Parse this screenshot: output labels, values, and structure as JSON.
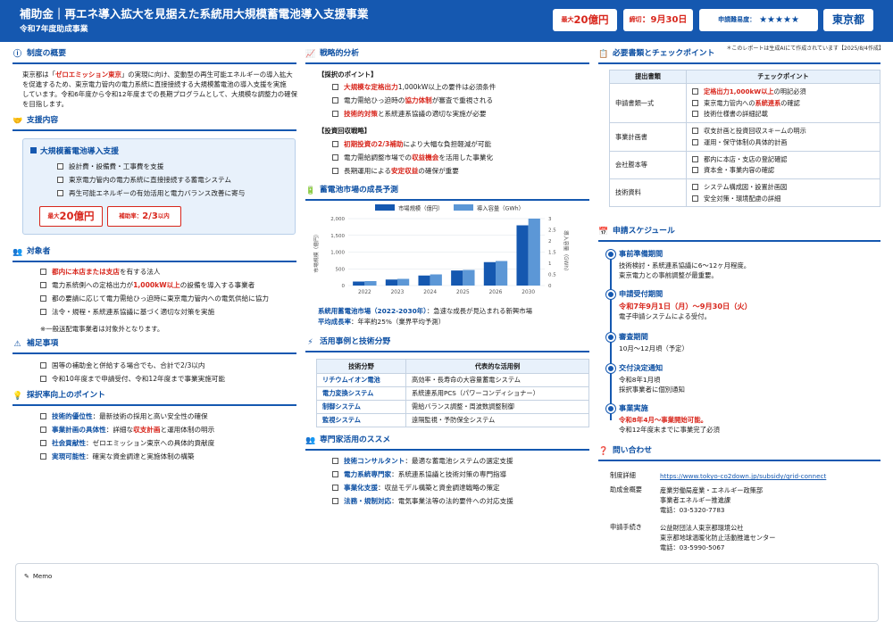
{
  "header": {
    "title": "補助金｜再エネ導入拡大を見据えた系統用大規模蓄電池導入支援事業",
    "subtitle": "令和7年度助成事業",
    "badge_max_prefix": "最大",
    "badge_max_value": "20億円",
    "badge_deadline_prefix": "締切",
    "badge_deadline_value": "：9月30日",
    "badge_difficulty_label": "申請難易度：",
    "badge_difficulty_stars": "★★★★★",
    "badge_region": "東京都"
  },
  "note": "＊このレポートは生成AIにて作成されています【2025/8/4作成】",
  "overview": {
    "title": "制度の概要",
    "p_prefix": "東京都は「",
    "p_highlight": "ゼロエミッション東京",
    "p_line1_rest": "」の実現に向け、変動型の再生可能エネルギーの導入拡大",
    "p_line2": "を促進するため、東京電力管内の電力系統に直接接続する大規模蓄電池の導入支援を実施",
    "p_line3": "しています。令和6年度から令和12年度までの長期プログラムとして、大規模な調整力の確保",
    "p_line4": "を目指します。"
  },
  "support": {
    "title": "支援内容",
    "box_title": "大規模蓄電池導入支援",
    "items": [
      "設計費・設備費・工事費を支援",
      "東京電力管内の電力系統に直接接続する蓄電システム",
      "再生可能エネルギーの有効活用と電力バランス改善に寄与"
    ],
    "badge_max_prefix": "最大",
    "badge_max_value": "20億円",
    "badge_rate_prefix": "補助率：",
    "badge_rate_value": "2/3",
    "badge_rate_suffix": "以内"
  },
  "target": {
    "title": "対象者",
    "item1_hl": "都内に本店または支店",
    "item1_rest": "を有する法人",
    "item2_pre": "電力系統側への定格出力が",
    "item2_hl": "1,000kW以上",
    "item2_rest": "の設備を導入する事業者",
    "item3": "都の要請に応じて電力需給ひっ迫時に東京電力管内への電気供給に協力",
    "item4": "法令・規程・系統連系協議に基づく適切な対策を実施",
    "note": "※一般送配電事業者は対象外となります。"
  },
  "supplement": {
    "title": "補足事項",
    "items": [
      "国等の補助金と併給する場合でも、合計で2/3以内",
      "令和10年度まで申請受付、令和12年度まで事業実施可能"
    ]
  },
  "tips": {
    "title": "採択率向上のポイント",
    "item1_k": "技術的優位性",
    "item1_v": "：最新技術の採用と高い安全性の確保",
    "item2_k": "事業計画の具体性",
    "item2_m": "：詳細な",
    "item2_hl": "収支計画",
    "item2_v": "と運用体制の明示",
    "item3_k": "社会貢献性",
    "item3_v": "：ゼロエミッション東京への具体的貢献度",
    "item4_k": "実現可能性",
    "item4_v": "：確実な資金調達と実施体制の構築"
  },
  "strategy": {
    "title": "戦略的分析",
    "adopt_head": "【採択のポイント】",
    "a1_hl": "大規模な定格出力",
    "a1_rest": "1,000kW以上の要件は必須条件",
    "a2_pre": "電力需給ひっ迫時の",
    "a2_hl": "協力体制",
    "a2_rest": "が審査で重視される",
    "a3_hl": "技術的対策",
    "a3_rest": "と系統連系協議の適切な実施が必要",
    "invest_head": "【投資回収戦略】",
    "b1_hl": "初期投資の2/3補助",
    "b1_rest": "により大幅な負担軽減が可能",
    "b2_pre": "電力需給調整市場での",
    "b2_hl": "収益機会",
    "b2_rest": "を活用した事業化",
    "b3_pre": "長期運用による",
    "b3_hl": "安定収益",
    "b3_rest": "の確保が重要"
  },
  "market": {
    "title": "蓄電池市場の成長予測",
    "caption_label": "系統用蓄電池市場（2022-2030年）",
    "caption_text": "：急速な成長が見込まれる新興市場",
    "growth_label": "平均成長率",
    "growth_text": "：年率約25%（業界平均予測）"
  },
  "chart_data": {
    "type": "bar",
    "categories": [
      "2022",
      "2023",
      "2024",
      "2025",
      "2026",
      "2030"
    ],
    "series": [
      {
        "name": "市場規模（億円）",
        "values": [
          120,
          180,
          300,
          450,
          700,
          1800
        ],
        "color": "#1558b0"
      },
      {
        "name": "導入容量（GWh）",
        "values": [
          0.2,
          0.3,
          0.5,
          0.7,
          1.1,
          3.0
        ],
        "color": "#5c97d6"
      }
    ],
    "ylabel": "市場規模（億円）",
    "y2label": "導入容量（GWh）",
    "ylim": [
      0,
      2000
    ],
    "y2lim": [
      0,
      3.0
    ],
    "yticks": [
      "0",
      "500",
      "1,000",
      "1,500",
      "2,000"
    ],
    "y2ticks": [
      "0",
      "0.5",
      "1",
      "1.5",
      "2",
      "2.5",
      "3"
    ],
    "legend_position": "top",
    "grid": true
  },
  "usecases": {
    "title": "活用事例と技術分野",
    "col1": "技術分野",
    "col2": "代表的な活用例",
    "rows": [
      {
        "k": "リチウムイオン電池",
        "v": "高効率・長寿命の大容量蓄電システム"
      },
      {
        "k": "電力変換システム",
        "v": "系統連系用PCS（パワーコンディショナー）"
      },
      {
        "k": "制御システム",
        "v": "需給バランス調整・周波数調整制御"
      },
      {
        "k": "監視システム",
        "v": "遠隔監視・予防保全システム"
      }
    ]
  },
  "experts": {
    "title": "専門家活用のススメ",
    "items": [
      {
        "k": "技術コンサルタント",
        "v": "：最適な蓄電池システムの選定支援"
      },
      {
        "k": "電力系統専門家",
        "v": "：系統連系協議と技術対策の専門指導"
      },
      {
        "k": "事業化支援",
        "v": "：収益モデル構築と資金調達戦略の策定"
      },
      {
        "k": "法務・規制対応",
        "v": "：電気事業法等の法的要件への対応支援"
      }
    ]
  },
  "documents": {
    "title": "必要書類とチェックポイント",
    "col1": "提出書類",
    "col2": "チェックポイント",
    "groups": [
      {
        "doc": "申請書類一式",
        "checks": [
          "定格出力1,000kW以上",
          "東京電力管内への系統連系の確認",
          "技術仕様書の詳細記載"
        ]
      },
      {
        "doc": "事業計画書",
        "checks": [
          "収支計画と投資回収スキームの明示",
          "運用・保守体制の具体的計画"
        ]
      },
      {
        "doc": "会社謄本等",
        "checks": [
          "都内に本店・支店の登記確認",
          "資本金・事業内容の確認"
        ]
      },
      {
        "doc": "技術資料",
        "checks": [
          "システム構成図・設置計画図",
          "安全対策・環境配慮の詳細"
        ]
      }
    ],
    "c1_suffix": "の明記必須",
    "c2_pre": "東京電力管内への",
    "c2_hl": "系統連系",
    "c2_rest": "の確認"
  },
  "schedule": {
    "title": "申請スケジュール",
    "s1_head": "事前準備期間",
    "s1_l1": "技術検討・系統連系協議に6〜12ヶ月程度。",
    "s1_l2": "東京電力との事前調整が最重要。",
    "s2_head": "申請受付期間",
    "s2_hl": "令和7年9月1日（月）〜9月30日（火）",
    "s2_l2": "電子申請システムによる受付。",
    "s3_head": "審査期間",
    "s3_l1": "10月〜12月頃（予定）",
    "s4_head": "交付決定通知",
    "s4_l1": "令和8年1月頃",
    "s4_l2": "採択事業者に個別通知",
    "s5_head": "事業実施",
    "s5_hl": "令和8年4月〜事業開始可能。",
    "s5_l2": "令和12年度末までに事業完了必須"
  },
  "contact": {
    "title": "問い合わせ",
    "r1_label": "制度詳細",
    "r1_val": "https://www.tokyo-co2down.jp/subsidy/grid-connect",
    "r2_label": "助成金概要",
    "r2_l1": "産業労働局産業・エネルギー政策部",
    "r2_l2": "事業者エネルギー推進課",
    "r2_l3": "電話：03-5320-7783",
    "r3_label": "申請手続き",
    "r3_l1": "公益財団法人東京都環境公社",
    "r3_l2": "東京都地球温暖化防止活動推進センター",
    "r3_l3": "電話：03-5990-5067"
  },
  "memo": {
    "label": "Memo"
  }
}
